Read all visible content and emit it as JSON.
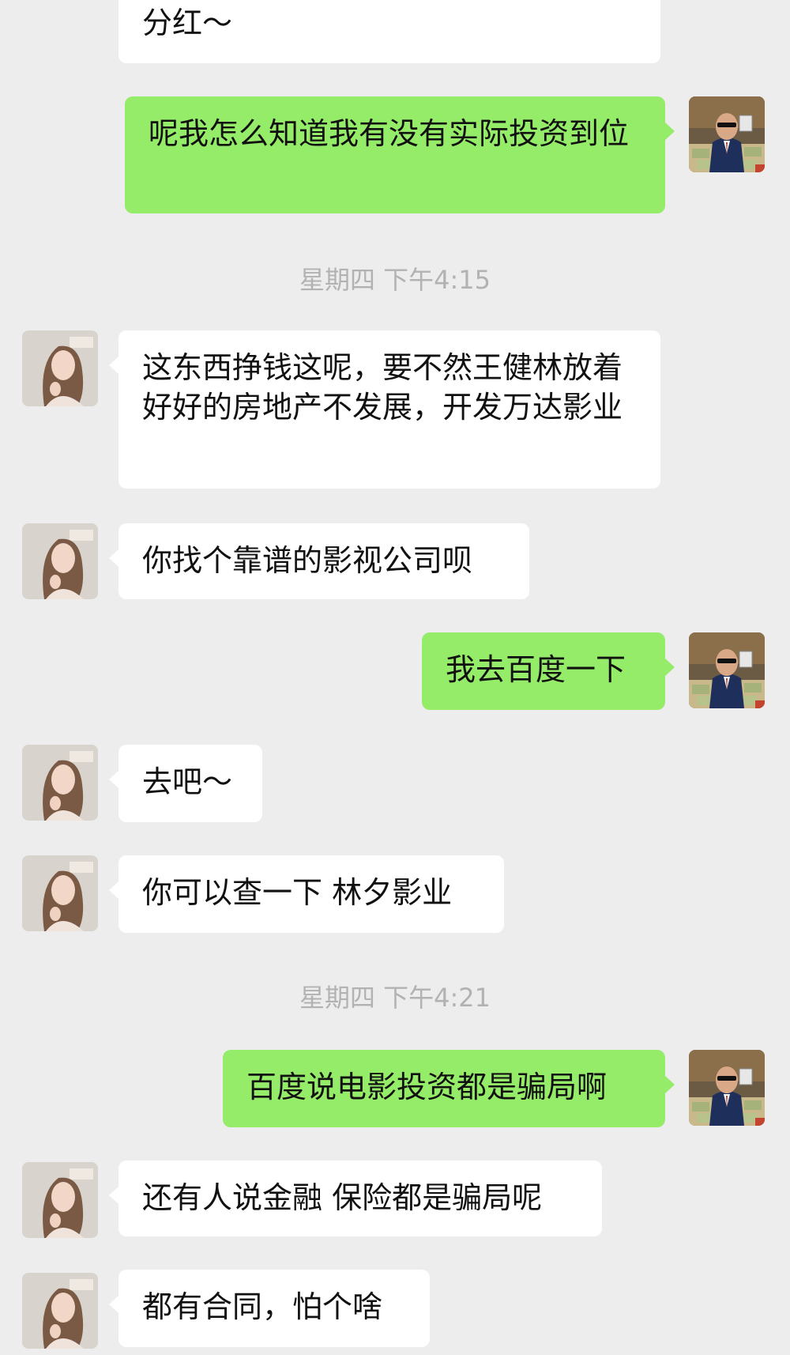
{
  "conversation": {
    "messages": [
      {
        "sender": "contact",
        "text": "分红～"
      },
      {
        "sender": "me",
        "text": "呢我怎么知道我有没有实际投资到位"
      },
      {
        "type": "timestamp",
        "text": "星期四 下午4:15"
      },
      {
        "sender": "contact",
        "text": "这东西挣钱这呢，要不然王健林放着好好的房地产不发展，开发万达影业"
      },
      {
        "sender": "contact",
        "text": "你找个靠谱的影视公司呗"
      },
      {
        "sender": "me",
        "text": "我去百度一下"
      },
      {
        "sender": "contact",
        "text": "去吧～"
      },
      {
        "sender": "contact",
        "text": "你可以查一下 林夕影业"
      },
      {
        "type": "timestamp",
        "text": "星期四 下午4:21"
      },
      {
        "sender": "me",
        "text": "百度说电影投资都是骗局啊"
      },
      {
        "sender": "contact",
        "text": "还有人说金融 保险都是骗局呢"
      },
      {
        "sender": "contact",
        "text": "都有合同，怕个啥"
      }
    ]
  },
  "colors": {
    "background": "#ededed",
    "incoming_bubble": "#ffffff",
    "outgoing_bubble": "#95ec69",
    "timestamp_text": "#b2b2b2"
  },
  "icons": {
    "contact_avatar": "woman-portrait-avatar",
    "my_avatar": "man-with-money-avatar"
  }
}
